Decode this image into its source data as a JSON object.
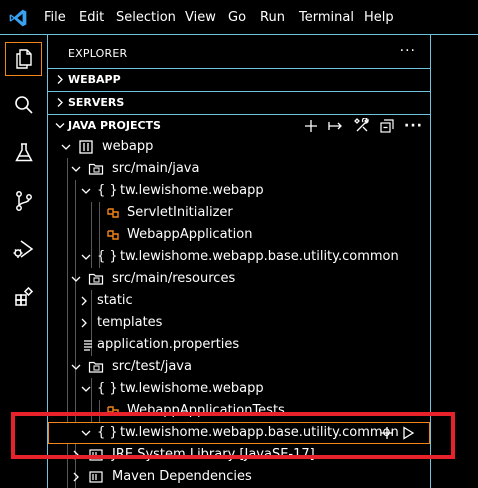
{
  "menu": {
    "items": [
      "File",
      "Edit",
      "Selection",
      "View",
      "Go",
      "Run",
      "Terminal",
      "Help"
    ]
  },
  "activity": {
    "icons": [
      "explorer-icon",
      "search-icon",
      "testing-icon",
      "source-control-icon",
      "run-debug-icon",
      "extensions-icon"
    ]
  },
  "explorer": {
    "title": "EXPLORER",
    "more": "···"
  },
  "sections": {
    "webapp": "WEBAPP",
    "servers": "SERVERS",
    "java_projects": "JAVA PROJECTS"
  },
  "tree": [
    {
      "label": "webapp"
    },
    {
      "label": "src/main/java"
    },
    {
      "label": "tw.lewishome.webapp"
    },
    {
      "label": "ServletInitializer"
    },
    {
      "label": "WebappApplication"
    },
    {
      "label": "tw.lewishome.webapp.base.utility.common"
    },
    {
      "label": "src/main/resources"
    },
    {
      "label": "static"
    },
    {
      "label": "templates"
    },
    {
      "label": "application.properties"
    },
    {
      "label": "src/test/java"
    },
    {
      "label": "tw.lewishome.webapp"
    },
    {
      "label": "WebappApplicationTests"
    },
    {
      "label": "tw.lewishome.webapp.base.utility.common"
    },
    {
      "label": "JRE System Library [JavaSE-17]"
    },
    {
      "label": "Maven Dependencies"
    }
  ],
  "colors": {
    "accent_border": "#6fc3df",
    "focus_outline": "#f38518",
    "highlight_box": "#e8222a",
    "class_icon": "#f38518"
  }
}
